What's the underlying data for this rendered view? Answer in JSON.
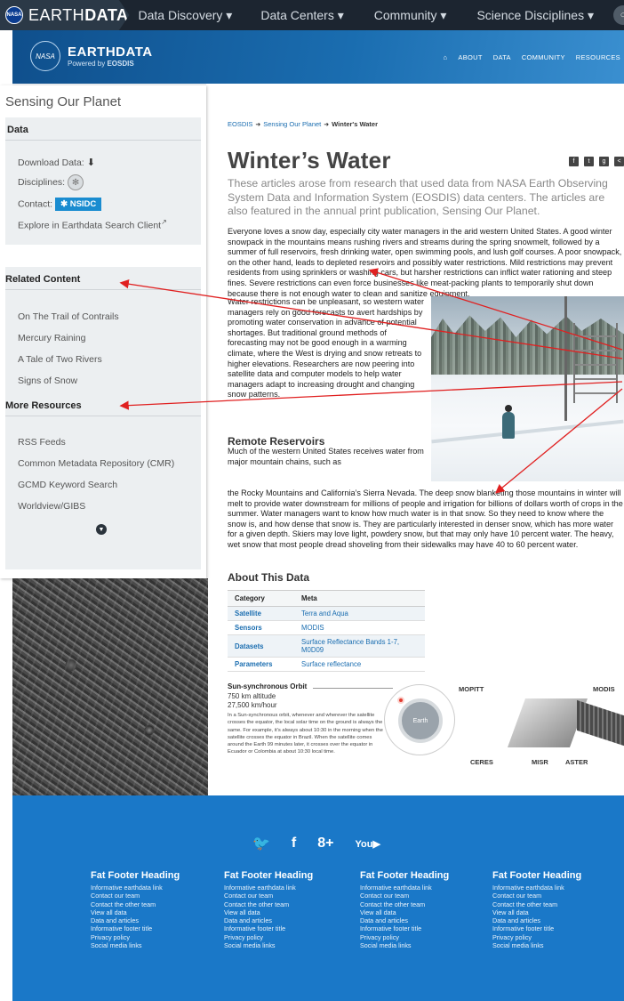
{
  "topbar": {
    "brand_bold": "DATA",
    "brand_light": "EARTH",
    "nasa_label": "NASA",
    "nav": [
      "Data Discovery ▾",
      "Data Centers ▾",
      "Community ▾",
      "Science Disciplines ▾"
    ]
  },
  "hero": {
    "logo_title": "EARTHDATA",
    "logo_powered": "Powered by ",
    "logo_powered_bold": "EOSDIS",
    "logo_mark": "NASA",
    "menu": [
      "ABOUT",
      "DATA",
      "COMMUNITY",
      "RESOURCES"
    ]
  },
  "sidebar": {
    "title": "Sensing Our Planet",
    "data_box": {
      "heading": "Data",
      "download_label": "Download Data:",
      "disciplines_label": "Disciplines:",
      "contact_label": "Contact:",
      "contact_badge": "✱ NSIDC",
      "explore_label": "Explore in Earthdata Search Client"
    },
    "related": {
      "heading": "Related Content",
      "items": [
        "On The Trail of Contrails",
        "Mercury Raining",
        "A Tale of Two Rivers",
        "Signs of Snow"
      ]
    },
    "resources": {
      "heading": "More Resources",
      "items": [
        "RSS Feeds",
        "Common Metadata Repository (CMR)",
        "GCMD Keyword Search",
        "Worldview/GIBS"
      ]
    }
  },
  "main": {
    "breadcrumb": [
      "EOSDIS",
      "Sensing Our Planet",
      "Winter's Water"
    ],
    "title": "Winter’s Water",
    "intro": "These articles arose from research that used data from NASA Earth Observing System Data and Information System (EOSDIS) data centers. The articles are also featured in the annual print publication, Sensing Our Planet.",
    "para1": "Everyone loves a snow day, especially city water managers in the arid western United States. A good winter snowpack in the mountains means rushing rivers and streams during the spring snowmelt, followed by a summer of full reservoirs, fresh drinking water, open swimming pools, and lush golf courses. A poor snowpack, on the other hand, leads to depleted reservoirs and possibly water restrictions. Mild restrictions may prevent residents from using sprinklers or washing cars, but harsher restrictions can inflict water rationing and steep fines. Severe restrictions can even force businesses like meat-packing plants to temporarily shut down because there is not enough water to clean and sanitize equipment.",
    "para2": "Water restrictions can be unpleasant, so western water managers rely on good forecasts to avert hardships by promoting water conservation in advance of potential shortages. But traditional ground methods of forecasting may not be good enough in a warming climate, where the West is drying and snow retreats to higher elevations. Researchers are now peering into satellite data and computer models to help water managers adapt to increasing drought and changing snow patterns.",
    "h_remote": "Remote Reservoirs",
    "para3a": "Much of the western United States receives water from major mountain chains, such as",
    "para3b": "the Rocky Mountains and California’s Sierra Nevada. The deep snow blanketing those mountains in winter will melt to provide water downstream for millions of people and irrigation for billions of dollars worth of crops in the summer. Water managers want to know how much water is in that snow. So they need to know where the snow is, and how dense that snow is. They are particularly interested in denser snow, which has more water for a given depth. Skiers may love light, powdery snow, but that may only have 10 percent water. The heavy, wet snow that most people dread shoveling from their sidewalks may have 40 to 60 percent water.",
    "h_about": "About This Data",
    "table": {
      "headers": [
        "Category",
        "Meta"
      ],
      "rows": [
        [
          "Satellite",
          "Terra and Aqua"
        ],
        [
          "Sensors",
          "MODIS"
        ],
        [
          "Datasets",
          "Surface Reflectance Bands 1-7, M0D09"
        ],
        [
          "Parameters",
          "Surface reflectance"
        ]
      ]
    },
    "orbit": {
      "title": "Sun-synchronous Orbit",
      "altitude": "750 km altitude",
      "speed": "27,500 km/hour",
      "text": "In a Sun-synchronous orbit, whenever and wherever the satellite crosses the equator, the local solar time on the ground is always the same. For example, it’s always about 10:30 in the morning when the satellite crosses the equator in Brazil. When the satellite comes around the Earth 99 minutes later, it crosses over the equator in Ecuador or Colombia at about 10:30 local time.",
      "earth_label": "Earth"
    },
    "instruments": [
      "MOPITT",
      "MODIS",
      "CERES",
      "MISR",
      "ASTER"
    ]
  },
  "footer": {
    "columns": [
      {
        "heading": "Fat Footer Heading",
        "links": [
          "Informative earthdata link",
          "Contact our team",
          "Contact the other team",
          "View all data",
          "Data and articles",
          "Informative footer title",
          "Privacy policy",
          "Social media links"
        ]
      },
      {
        "heading": "Fat Footer Heading",
        "links": [
          "Informative earthdata link",
          "Contact our team",
          "Contact the other team",
          "View all data",
          "Data and articles",
          "Informative footer title",
          "Privacy policy",
          "Social media links"
        ]
      },
      {
        "heading": "Fat Footer Heading",
        "links": [
          "Informative earthdata link",
          "Contact our team",
          "Contact the other team",
          "View all data",
          "Data and articles",
          "Informative footer title",
          "Privacy policy",
          "Social media links"
        ]
      },
      {
        "heading": "Fat Footer Heading",
        "links": [
          "Informative earthdata link",
          "Contact our team",
          "Contact the other team",
          "View all data",
          "Data and articles",
          "Informative footer title",
          "Privacy policy",
          "Social media links"
        ]
      }
    ]
  },
  "colors": {
    "accent": "#1a6db0",
    "footer": "#1a78c8",
    "arrow": "#e02020"
  }
}
